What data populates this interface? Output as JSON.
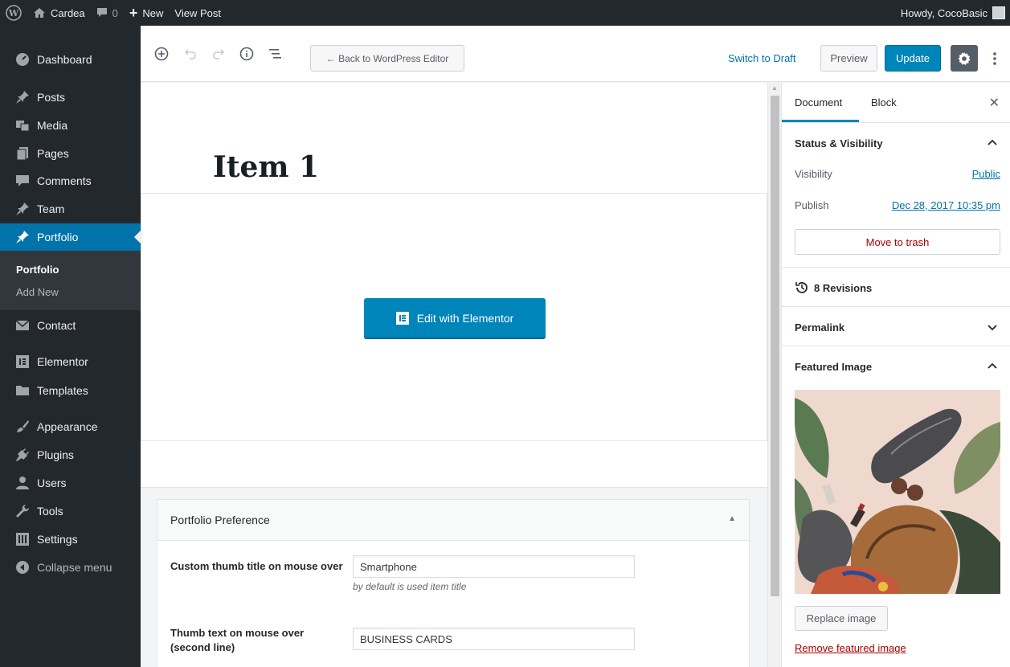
{
  "adminbar": {
    "site_name": "Cardea",
    "comments_count": "0",
    "new_label": "New",
    "view_post_label": "View Post",
    "howdy": "Howdy, CocoBasic"
  },
  "menu": {
    "dashboard": "Dashboard",
    "posts": "Posts",
    "media": "Media",
    "pages": "Pages",
    "comments": "Comments",
    "team": "Team",
    "portfolio": "Portfolio",
    "portfolio_sub": "Portfolio",
    "add_new": "Add New",
    "contact": "Contact",
    "elementor": "Elementor",
    "templates": "Templates",
    "appearance": "Appearance",
    "plugins": "Plugins",
    "users": "Users",
    "tools": "Tools",
    "settings": "Settings",
    "collapse": "Collapse menu"
  },
  "toolbar": {
    "back_label": "← Back to WordPress Editor",
    "switch_draft": "Switch to Draft",
    "preview": "Preview",
    "update": "Update"
  },
  "editor": {
    "title": "Item 1",
    "elementor_button": "Edit with Elementor"
  },
  "metabox": {
    "title": "Portfolio Preference",
    "field1_label": "Custom thumb title on mouse over",
    "field1_value": "Smartphone",
    "field1_desc": "by default is used item title",
    "field2_label": "Thumb text on mouse over (second line)",
    "field2_value": "BUSINESS CARDS"
  },
  "sidebar": {
    "tab_document": "Document",
    "tab_block": "Block",
    "status_title": "Status & Visibility",
    "visibility_label": "Visibility",
    "visibility_value": "Public",
    "publish_label": "Publish",
    "publish_value": "Dec 28, 2017 10:35 pm",
    "trash": "Move to trash",
    "revisions": "8 Revisions",
    "permalink": "Permalink",
    "featured_title": "Featured Image",
    "replace": "Replace image",
    "remove": "Remove featured image"
  },
  "colors": {
    "admin_dark": "#23282d",
    "accent": "#0073aa",
    "button_primary": "#0085ba",
    "danger": "#a00"
  }
}
